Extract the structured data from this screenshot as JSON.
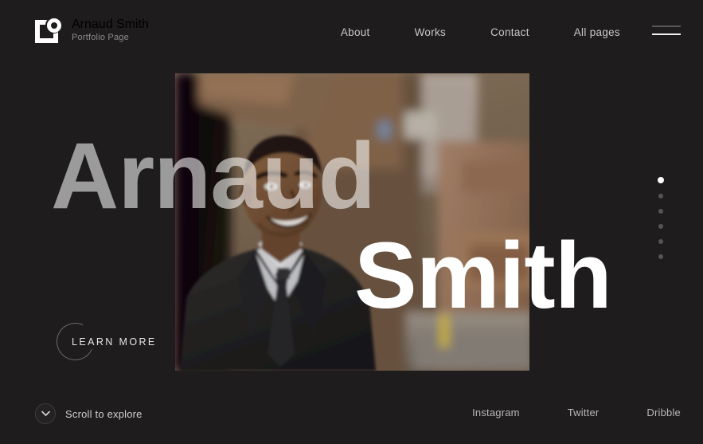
{
  "theme": {
    "background": "#1e1c1d",
    "text_primary": "#ffffff",
    "text_muted": "#8d8c8c",
    "accent": "#ffffff"
  },
  "header": {
    "logo_icon": "camera-square-logo-icon",
    "brand_title": "Arnaud Smith",
    "brand_subtitle": "Portfolio Page",
    "nav": [
      {
        "label": "About"
      },
      {
        "label": "Works"
      },
      {
        "label": "Contact"
      },
      {
        "label": "All pages"
      }
    ],
    "menu_icon": "hamburger-menu-icon"
  },
  "hero": {
    "name_first": "Arnaud",
    "name_last": "Smith",
    "photo_alt": "Man in dark suit and tie smiling on a city street",
    "cta": {
      "label": "LEARN MORE",
      "icon": "circle-arc-icon"
    }
  },
  "slide_nav": {
    "total": 6,
    "active_index": 0,
    "dots": [
      {
        "active": true
      },
      {
        "active": false
      },
      {
        "active": false
      },
      {
        "active": false
      },
      {
        "active": false
      },
      {
        "active": false
      }
    ]
  },
  "footer": {
    "scroll": {
      "label": "Scroll to explore",
      "icon": "chevron-down-circle-icon"
    },
    "socials": [
      {
        "label": "Instagram"
      },
      {
        "label": "Twitter"
      },
      {
        "label": "Dribble"
      }
    ]
  }
}
